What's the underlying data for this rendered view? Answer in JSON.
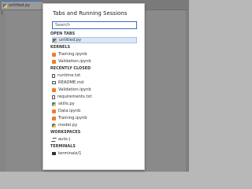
{
  "editor": {
    "tab_label": "untitled.py",
    "line_number": "1"
  },
  "palette": {
    "title": "Tabs and Running Sessions",
    "search_placeholder": "Search",
    "sections": {
      "open_tabs": "OPEN TABS",
      "kernels": "KERNELS",
      "recently_closed": "RECENTLY CLOSED",
      "workspaces": "WORKSPACES",
      "terminals": "TERMINALS"
    },
    "open_tabs": [
      {
        "label": "untitled.py",
        "icon": "python-file-icon"
      }
    ],
    "kernels": [
      {
        "label": "Training.ipynb",
        "icon": "notebook-icon"
      },
      {
        "label": "Validation.ipynb",
        "icon": "notebook-icon"
      }
    ],
    "recently_closed": [
      {
        "label": "runtime.txt",
        "icon": "text-file-icon"
      },
      {
        "label": "README.md",
        "icon": "markdown-file-icon"
      },
      {
        "label": "Validation.ipynb",
        "icon": "notebook-icon"
      },
      {
        "label": "requirements.txt",
        "icon": "text-file-icon"
      },
      {
        "label": "skills.py",
        "icon": "python-file-icon"
      },
      {
        "label": "Data.ipynb",
        "icon": "notebook-icon"
      },
      {
        "label": "Training.ipynb",
        "icon": "notebook-icon"
      },
      {
        "label": "model.py",
        "icon": "python-file-icon"
      }
    ],
    "workspaces": [
      {
        "label": "auto-j",
        "icon": "workspace-icon"
      }
    ],
    "terminals": [
      {
        "label": "terminals/1",
        "icon": "terminal-icon"
      }
    ]
  }
}
